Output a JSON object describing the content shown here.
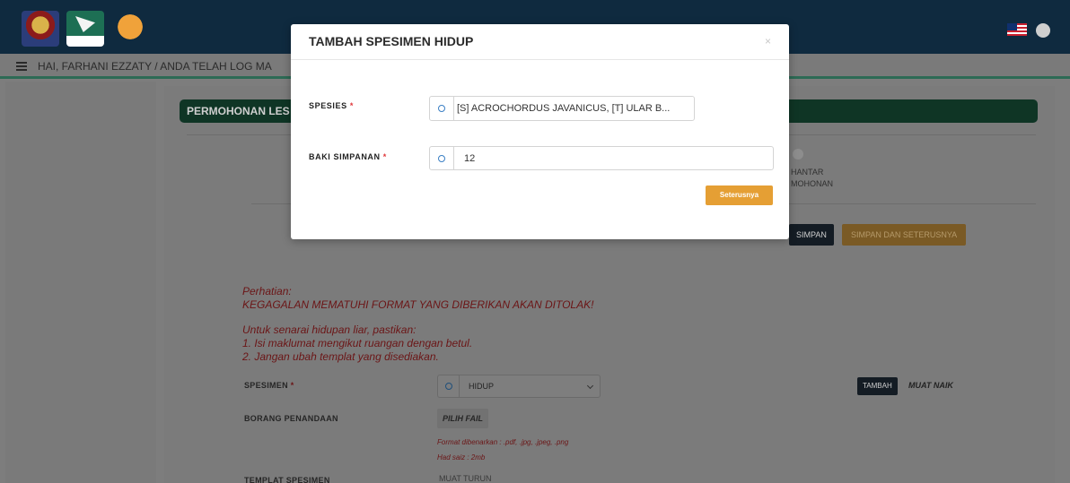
{
  "navbar": {
    "greeting": "HAI, FARHANI EZZATY / ANDA TELAH LOG MA"
  },
  "page": {
    "card_title": "PERMOHONAN LES",
    "step_label": "HANTAR\nMOHONAN",
    "simpan_label": "SIMPAN",
    "simpan_next_label": "SIMPAN DAN SETERUSNYA",
    "notice": {
      "line1": "Perhatian:",
      "line2": "KEGAGALAN MEMATUHI FORMAT YANG DIBERIKAN AKAN DITOLAK!",
      "line3": "Untuk senarai hidupan liar, pastikan:",
      "line4": "1. Isi maklumat mengikut ruangan dengan betul.",
      "line5": "2. Jangan ubah templat yang disediakan."
    },
    "spesimen_label": "SPESIMEN",
    "spesimen_value": "HIDUP",
    "tambah_label": "TAMBAH",
    "muat_naik_label": "MUAT NAIK",
    "borang_label": "BORANG PENANDAAN",
    "pilih_fail_label": "PILIH FAIL",
    "format_hint": "Format dibenarkan : .pdf, .jpg, .jpeg, .png",
    "size_hint": "Had saiz : 2mb",
    "templat_label": "TEMPLAT SPESIMEN",
    "muat_turun_label": "MUAT TURUN",
    "required_mark": "*"
  },
  "modal": {
    "title": "TAMBAH SPESIMEN HIDUP",
    "close": "×",
    "spesies_label": "SPESIES",
    "spesies_value": "[S] ACROCHORDUS JAVANICUS, [T] ULAR B...",
    "baki_label": "BAKI SIMPANAN",
    "baki_value": "12",
    "submit_label": "Seterusnya",
    "required_mark": "*"
  }
}
